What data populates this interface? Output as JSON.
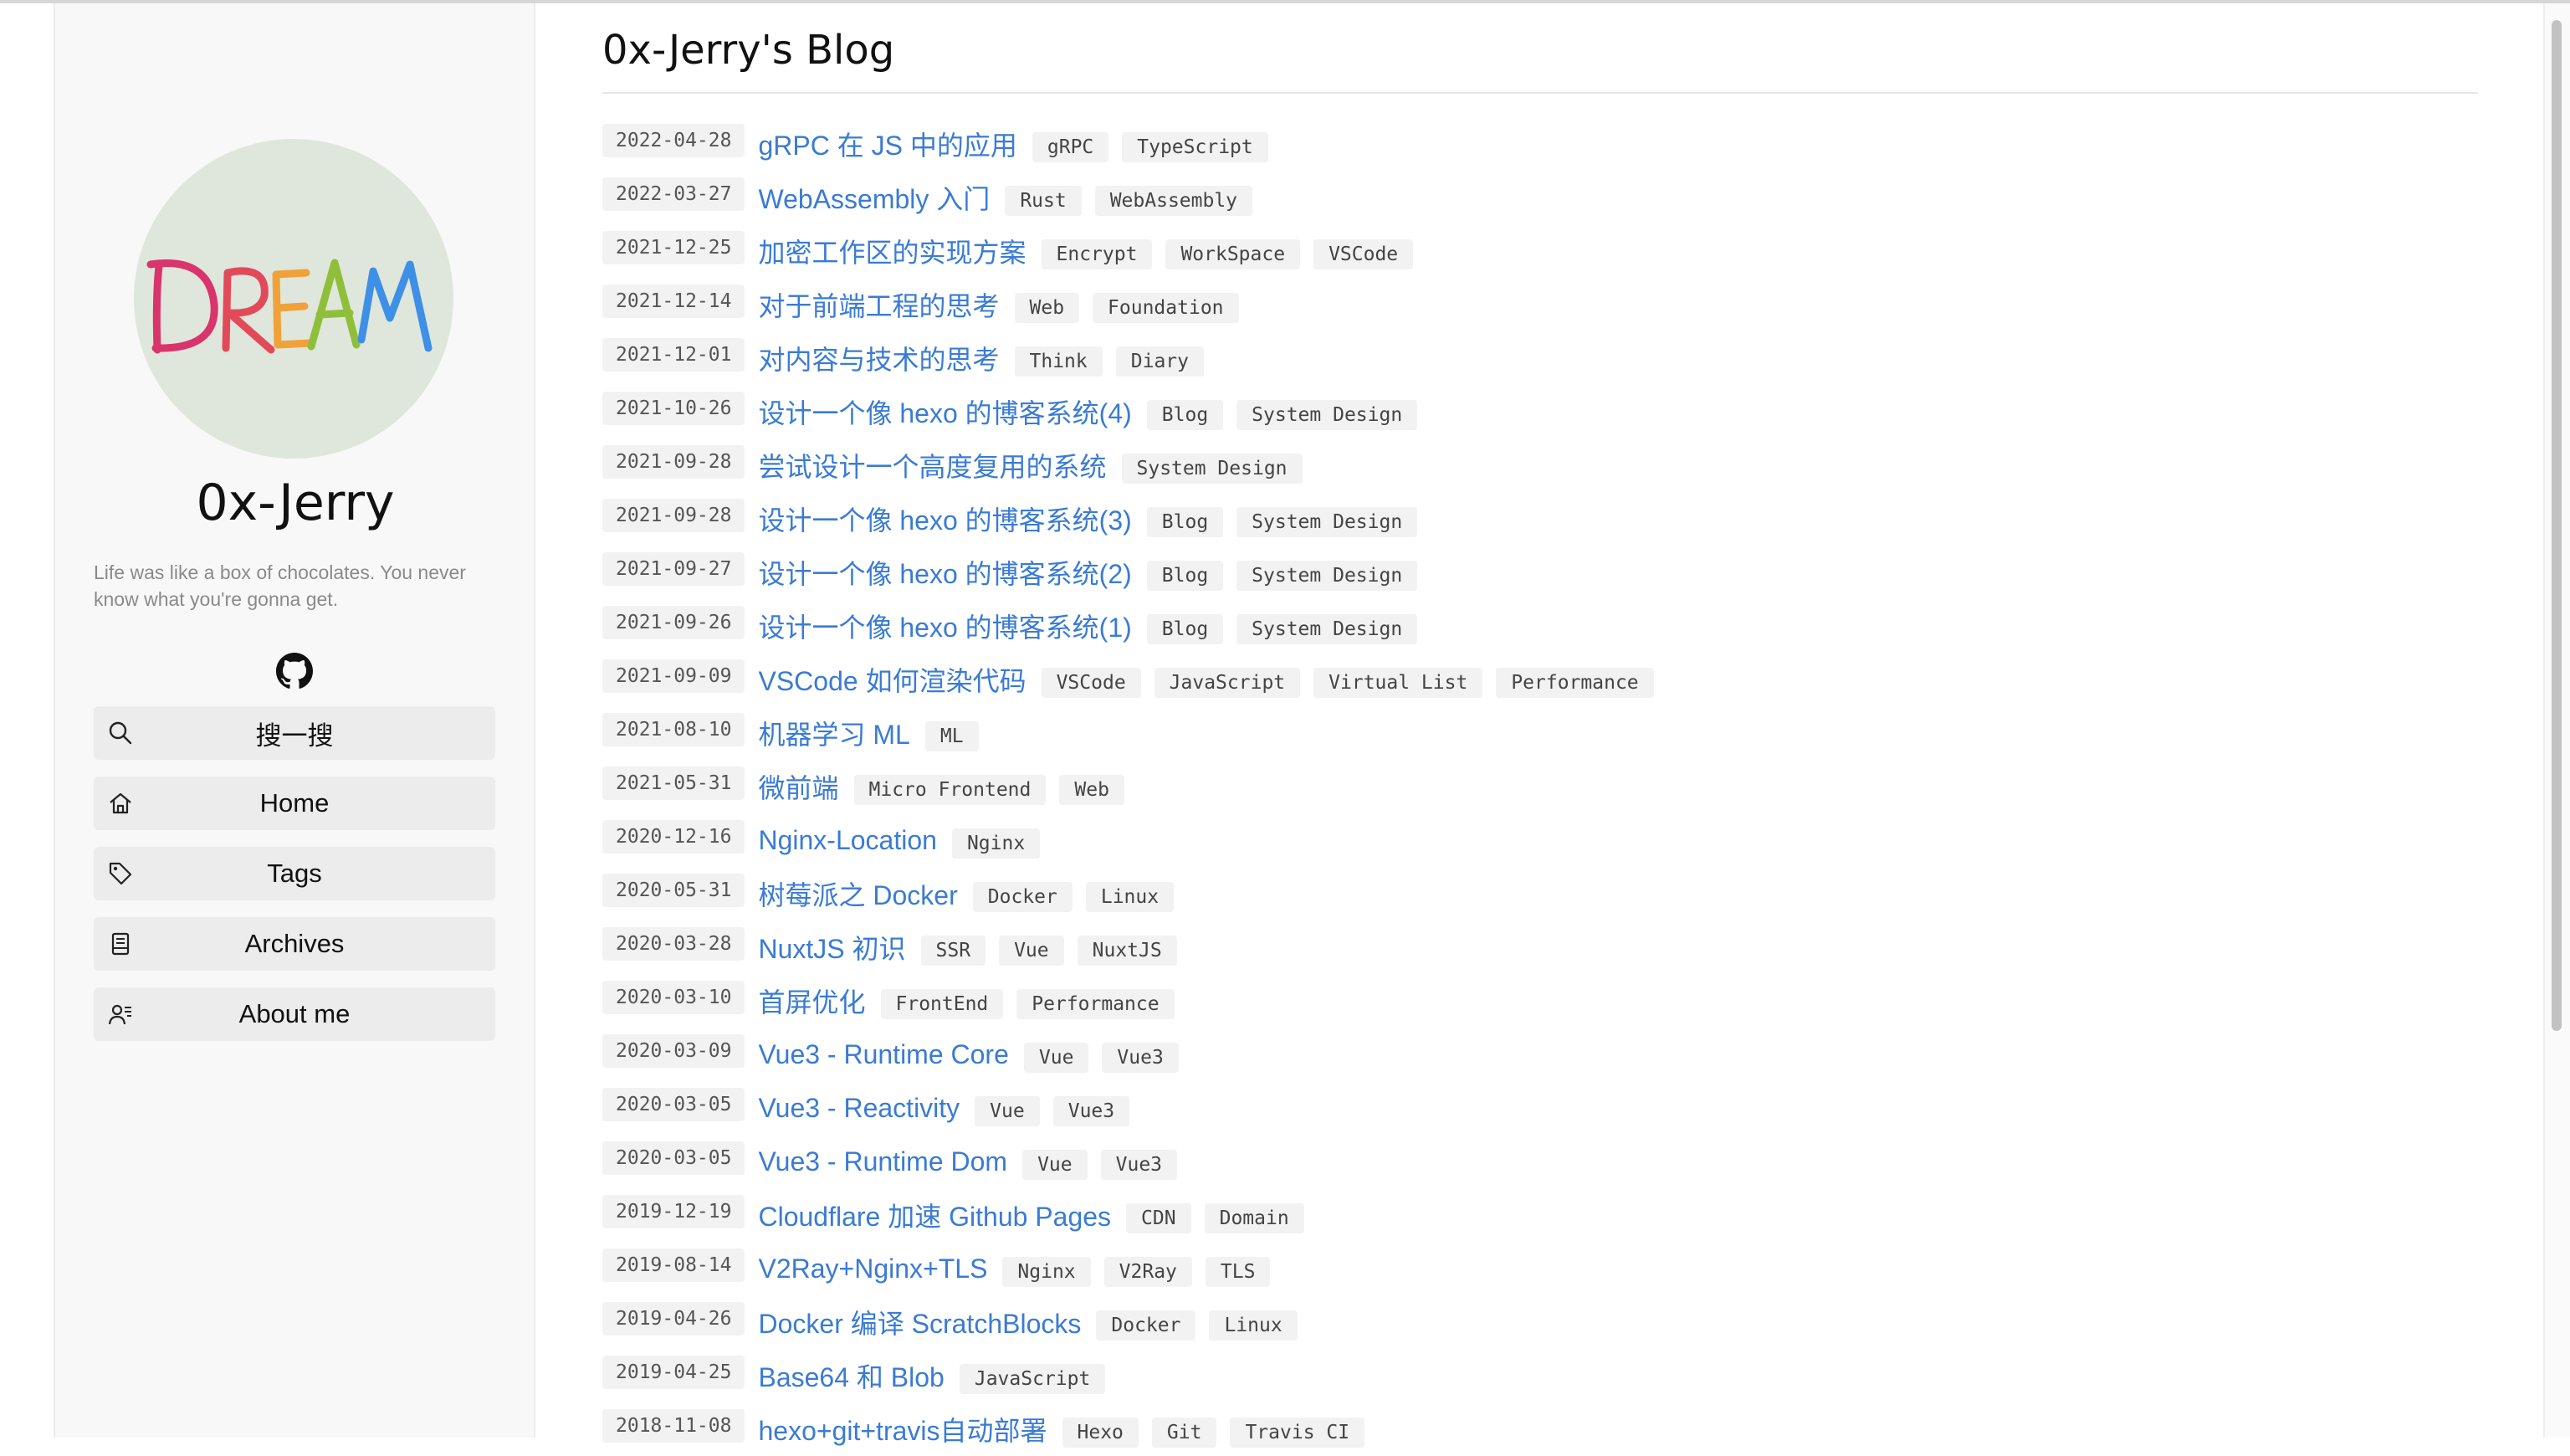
{
  "site": {
    "name": "0x-Jerry",
    "tagline": "Life was like a box of chocolates. You never know what you're gonna get.",
    "avatar_text": "DREAM"
  },
  "nav": {
    "items": [
      {
        "label": "搜一搜",
        "icon": "search-icon"
      },
      {
        "label": "Home",
        "icon": "home-icon"
      },
      {
        "label": "Tags",
        "icon": "tag-icon"
      },
      {
        "label": "Archives",
        "icon": "archive-icon"
      },
      {
        "label": "About me",
        "icon": "user-icon"
      }
    ]
  },
  "main": {
    "title": "0x-Jerry's Blog",
    "posts": [
      {
        "date": "2022-04-28",
        "title": "gRPC 在 JS 中的应用",
        "tags": [
          "gRPC",
          "TypeScript"
        ]
      },
      {
        "date": "2022-03-27",
        "title": "WebAssembly 入门",
        "tags": [
          "Rust",
          "WebAssembly"
        ]
      },
      {
        "date": "2021-12-25",
        "title": "加密工作区的实现方案",
        "tags": [
          "Encrypt",
          "WorkSpace",
          "VSCode"
        ]
      },
      {
        "date": "2021-12-14",
        "title": "对于前端工程的思考",
        "tags": [
          "Web",
          "Foundation"
        ]
      },
      {
        "date": "2021-12-01",
        "title": "对内容与技术的思考",
        "tags": [
          "Think",
          "Diary"
        ]
      },
      {
        "date": "2021-10-26",
        "title": "设计一个像 hexo 的博客系统(4)",
        "tags": [
          "Blog",
          "System Design"
        ]
      },
      {
        "date": "2021-09-28",
        "title": "尝试设计一个高度复用的系统",
        "tags": [
          "System Design"
        ]
      },
      {
        "date": "2021-09-28",
        "title": "设计一个像 hexo 的博客系统(3)",
        "tags": [
          "Blog",
          "System Design"
        ]
      },
      {
        "date": "2021-09-27",
        "title": "设计一个像 hexo 的博客系统(2)",
        "tags": [
          "Blog",
          "System Design"
        ]
      },
      {
        "date": "2021-09-26",
        "title": "设计一个像 hexo 的博客系统(1)",
        "tags": [
          "Blog",
          "System Design"
        ]
      },
      {
        "date": "2021-09-09",
        "title": "VSCode 如何渲染代码",
        "tags": [
          "VSCode",
          "JavaScript",
          "Virtual List",
          "Performance"
        ]
      },
      {
        "date": "2021-08-10",
        "title": "机器学习 ML",
        "tags": [
          "ML"
        ]
      },
      {
        "date": "2021-05-31",
        "title": "微前端",
        "tags": [
          "Micro Frontend",
          "Web"
        ]
      },
      {
        "date": "2020-12-16",
        "title": "Nginx-Location",
        "tags": [
          "Nginx"
        ]
      },
      {
        "date": "2020-05-31",
        "title": "树莓派之 Docker",
        "tags": [
          "Docker",
          "Linux"
        ]
      },
      {
        "date": "2020-03-28",
        "title": "NuxtJS 初识",
        "tags": [
          "SSR",
          "Vue",
          "NuxtJS"
        ]
      },
      {
        "date": "2020-03-10",
        "title": "首屏优化",
        "tags": [
          "FrontEnd",
          "Performance"
        ]
      },
      {
        "date": "2020-03-09",
        "title": "Vue3 - Runtime Core",
        "tags": [
          "Vue",
          "Vue3"
        ]
      },
      {
        "date": "2020-03-05",
        "title": "Vue3 - Reactivity",
        "tags": [
          "Vue",
          "Vue3"
        ]
      },
      {
        "date": "2020-03-05",
        "title": "Vue3 - Runtime Dom",
        "tags": [
          "Vue",
          "Vue3"
        ]
      },
      {
        "date": "2019-12-19",
        "title": "Cloudflare 加速 Github Pages",
        "tags": [
          "CDN",
          "Domain"
        ]
      },
      {
        "date": "2019-08-14",
        "title": "V2Ray+Nginx+TLS",
        "tags": [
          "Nginx",
          "V2Ray",
          "TLS"
        ]
      },
      {
        "date": "2019-04-26",
        "title": "Docker 编译 ScratchBlocks",
        "tags": [
          "Docker",
          "Linux"
        ]
      },
      {
        "date": "2019-04-25",
        "title": "Base64 和 Blob",
        "tags": [
          "JavaScript"
        ]
      },
      {
        "date": "2018-11-08",
        "title": "hexo+git+travis自动部署",
        "tags": [
          "Hexo",
          "Git",
          "Travis CI"
        ]
      }
    ]
  },
  "colors": {
    "link": "#3a7bd5",
    "sidebar_bg": "#f8f8f8",
    "nav_bg": "#ececec",
    "avatar_bg": "#dfe7dc"
  }
}
